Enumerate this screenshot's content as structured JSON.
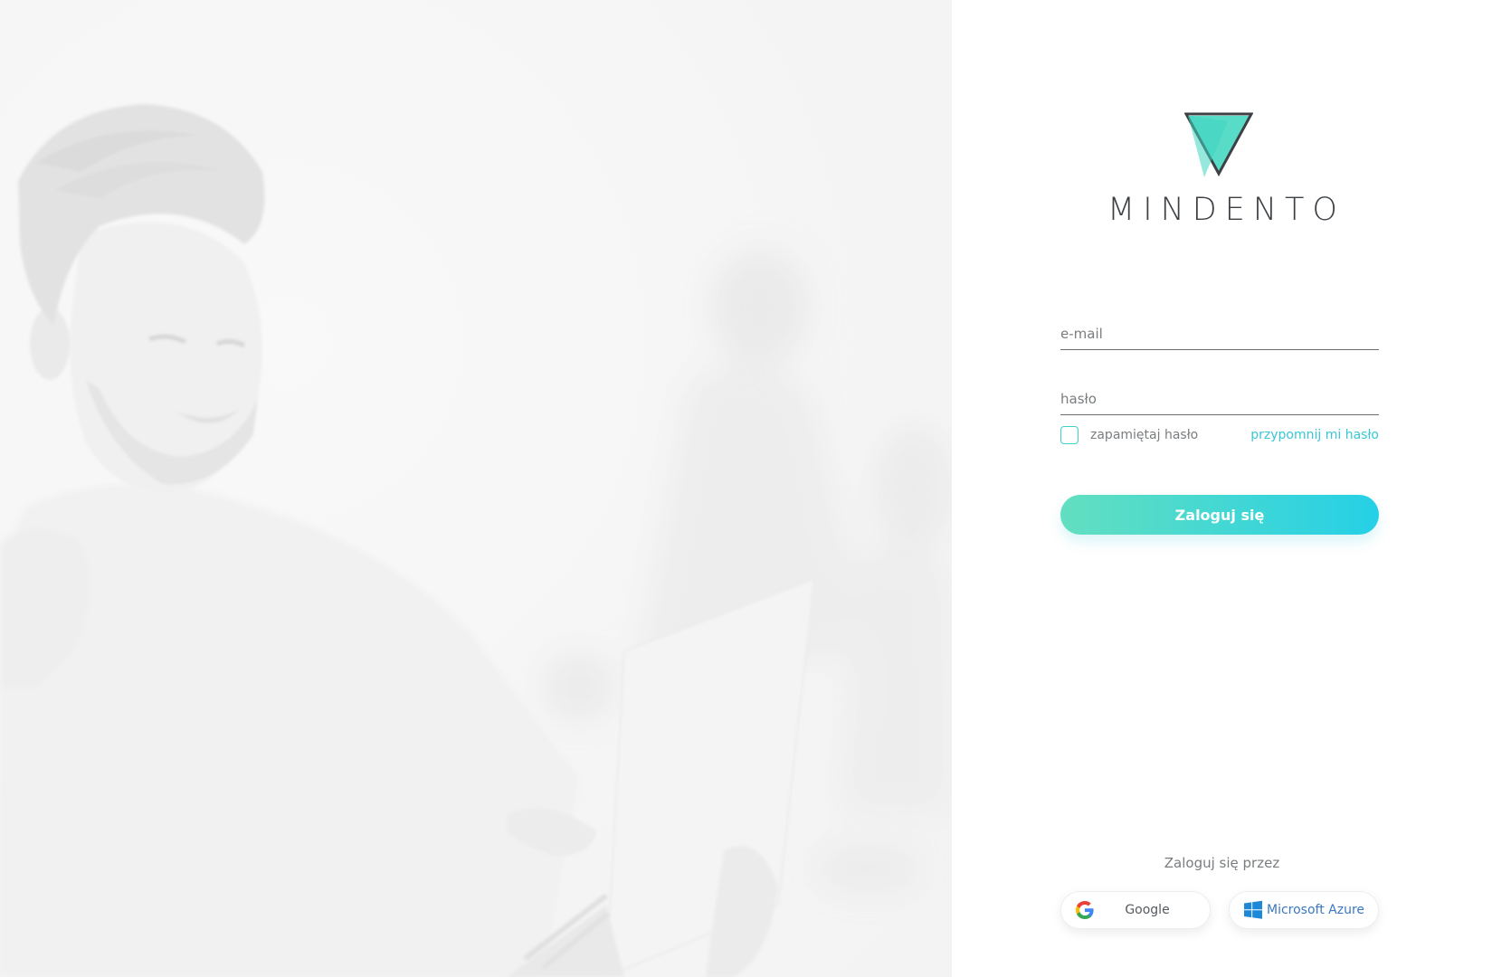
{
  "brand": {
    "name": "MINDENTO",
    "logo_colors": {
      "fill": "#4fd9c4",
      "outline": "#3d4145"
    }
  },
  "login_form": {
    "email_placeholder": "e-mail",
    "password_placeholder": "hasło",
    "remember_label": "zapamiętaj hasło",
    "remember_checked": false,
    "forgot_link": "przypomnij mi hasło",
    "submit_label": "Zaloguj się"
  },
  "sso": {
    "title": "Zaloguj się przez",
    "providers": [
      {
        "label": "Google",
        "icon": "google-icon"
      },
      {
        "label": "Microsoft Azure",
        "icon": "windows-icon"
      }
    ]
  },
  "colors": {
    "accent_start": "#63dfc0",
    "accent_end": "#25d0e6",
    "link": "#38c6d6",
    "text_muted": "#7a7d80"
  }
}
